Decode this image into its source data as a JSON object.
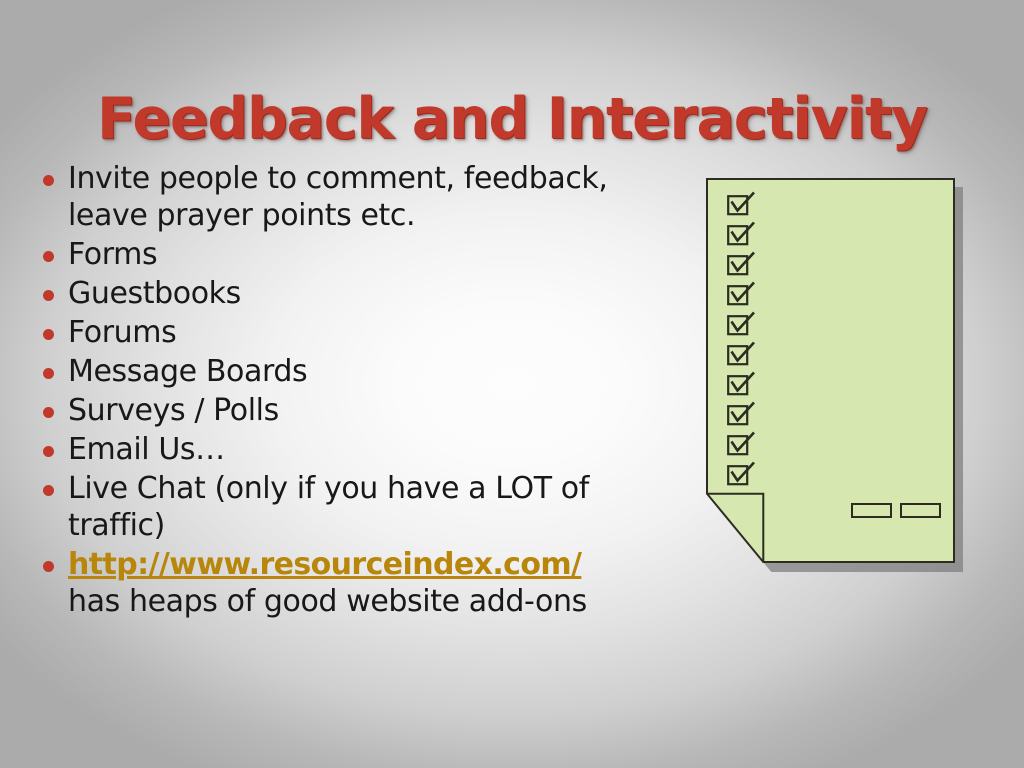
{
  "slide": {
    "title": "Feedback and Interactivity",
    "title_color": "#c0392b",
    "background": {
      "center_color": "#fcfcfc",
      "edge_color": "#ababab"
    },
    "bullet_marker_color": "#c0392b",
    "body_text_color": "#18181a",
    "link_color": "#b8860b"
  },
  "bullets": [
    {
      "line1": "Invite people to comment, feedback,",
      "line2": "leave prayer points etc."
    },
    {
      "line1": "Forms",
      "line2": ""
    },
    {
      "line1": "Guestbooks",
      "line2": ""
    },
    {
      "line1": "Forums",
      "line2": ""
    },
    {
      "line1": "Message Boards",
      "line2": ""
    },
    {
      "line1": "Surveys / Polls",
      "line2": ""
    },
    {
      "line1": "Email Us…",
      "line2": ""
    },
    {
      "line1": "Live Chat (only if you have a LOT of",
      "line2": "traffic)"
    }
  ],
  "link_bullet": {
    "url": "http://www.resourceindex.com/",
    "caption": "has heaps of good website add-ons"
  },
  "checklist_graphic": {
    "name": "checklist-page",
    "page_color": "#d6e8af",
    "outline_color": "#2c2c22",
    "shadow_color": "#7d7d7d",
    "checkbox_count": 10,
    "checkbox_icon": "checkmark-box-icon",
    "slot_count": 2,
    "folded_corner": "bottom-left"
  }
}
